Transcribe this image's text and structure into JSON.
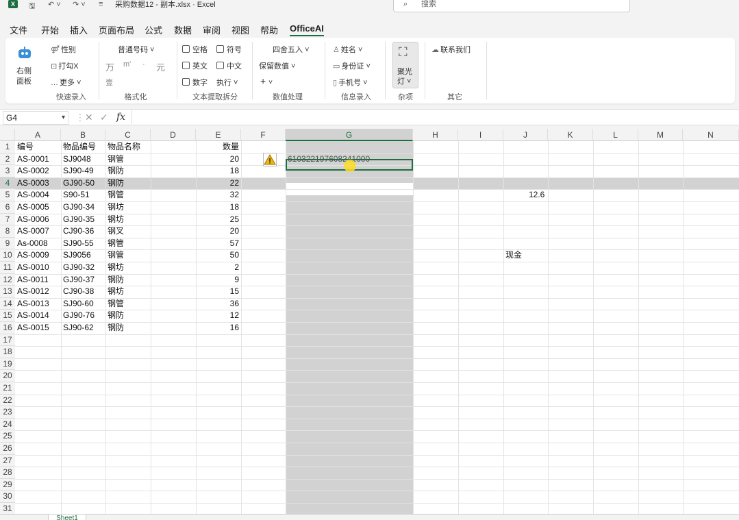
{
  "titlebar": {
    "app_icon": "X",
    "title": "采购数据12 - 副本.xlsx  ·  Excel",
    "search_placeholder": "搜索",
    "save_icon": "save-icon",
    "undo_icon": "undo-icon",
    "redo_icon": "redo-icon"
  },
  "menu": [
    "文件",
    "开始",
    "插入",
    "页面布局",
    "公式",
    "数据",
    "审阅",
    "视图",
    "帮助",
    "OfficeAI"
  ],
  "ribbon": {
    "assistant": {
      "label_line1": "右侧",
      "label_line2": "面板"
    },
    "quick_entry": {
      "gender": "性别",
      "check": "打勾X",
      "more": "更多",
      "group": "快速录入"
    },
    "format": {
      "font_select": "普通号码",
      "wan": "万",
      "m": "m'",
      "dot": "·",
      "yuan": "元",
      "misc": "壹",
      "group": "格式化"
    },
    "text_split": {
      "space": "空格",
      "symbol": "符号",
      "english": "英文",
      "chinese": "中文",
      "number": "数字",
      "execute": "执行",
      "group": "文本提取拆分"
    },
    "number_proc": {
      "round": "四舍五入",
      "keep_value": "保留数值",
      "plus": "+",
      "group": "数值处理"
    },
    "info_entry": {
      "name": "姓名",
      "idcard": "身份证",
      "phone": "手机号",
      "group": "信息录入"
    },
    "misc": {
      "spotlight_line1": "聚光",
      "spotlight_line2": "灯",
      "group": "杂项"
    },
    "other": {
      "contact": "联系我们",
      "group": "其它"
    }
  },
  "formula_bar": {
    "name_box": "G4",
    "fx": "fx",
    "cancel": "✕",
    "confirm": "✓",
    "content": ""
  },
  "columns": [
    "A",
    "B",
    "C",
    "D",
    "E",
    "F",
    "G",
    "H",
    "I",
    "J",
    "K",
    "L",
    "M",
    "N"
  ],
  "rows": [
    "1",
    "2",
    "3",
    "4",
    "5",
    "6",
    "7",
    "8",
    "9",
    "10",
    "11",
    "12",
    "13",
    "14",
    "15",
    "16",
    "17",
    "18",
    "19",
    "20",
    "21",
    "22",
    "23",
    "24",
    "25",
    "26",
    "27",
    "28",
    "29",
    "30",
    "31"
  ],
  "header_row": {
    "a": "编号",
    "b": "物品编号",
    "c": "物品名称",
    "e": "数量"
  },
  "data_rows": [
    {
      "a": "AS-0001",
      "b": "SJ9048",
      "c": "钢管",
      "e": "20"
    },
    {
      "a": "AS-0002",
      "b": "SJ90-49",
      "c": "钢防",
      "e": "18"
    },
    {
      "a": "AS-0003",
      "b": "GJ90-50",
      "c": "钢防",
      "e": "22"
    },
    {
      "a": "AS-0004",
      "b": "S90-51",
      "c": "钢管",
      "e": "32"
    },
    {
      "a": "AS-0005",
      "b": "GJ90-34",
      "c": "钢坊",
      "e": "18"
    },
    {
      "a": "AS-0006",
      "b": "GJ90-35",
      "c": "钢坊",
      "e": "25"
    },
    {
      "a": "AS-0007",
      "b": "CJ90-36",
      "c": "钢叉",
      "e": "20"
    },
    {
      "a": "As-0008",
      "b": "SJ90-55",
      "c": "钢管",
      "e": "57"
    },
    {
      "a": "AS-0009",
      "b": "SJ9056",
      "c": "钢管",
      "e": "50"
    },
    {
      "a": "AS-0010",
      "b": "GJ90-32",
      "c": "钢坊",
      "e": "2"
    },
    {
      "a": "AS-0011",
      "b": "GJ90-37",
      "c": "钢防",
      "e": "9"
    },
    {
      "a": "AS-0012",
      "b": "CJ90-38",
      "c": "钢坊",
      "e": "15"
    },
    {
      "a": "AS-0013",
      "b": "SJ90-60",
      "c": "钢管",
      "e": "36"
    },
    {
      "a": "AS-0014",
      "b": "GJ90-76",
      "c": "钢防",
      "e": "12"
    },
    {
      "a": "AS-0015",
      "b": "SJ90-62",
      "c": "钢防",
      "e": "16"
    }
  ],
  "cells": {
    "g2": "610322197608241000",
    "j5": "12.6",
    "j10": "现金"
  },
  "sheet_tab": "Sheet1",
  "accent_color": "#1d6f42"
}
